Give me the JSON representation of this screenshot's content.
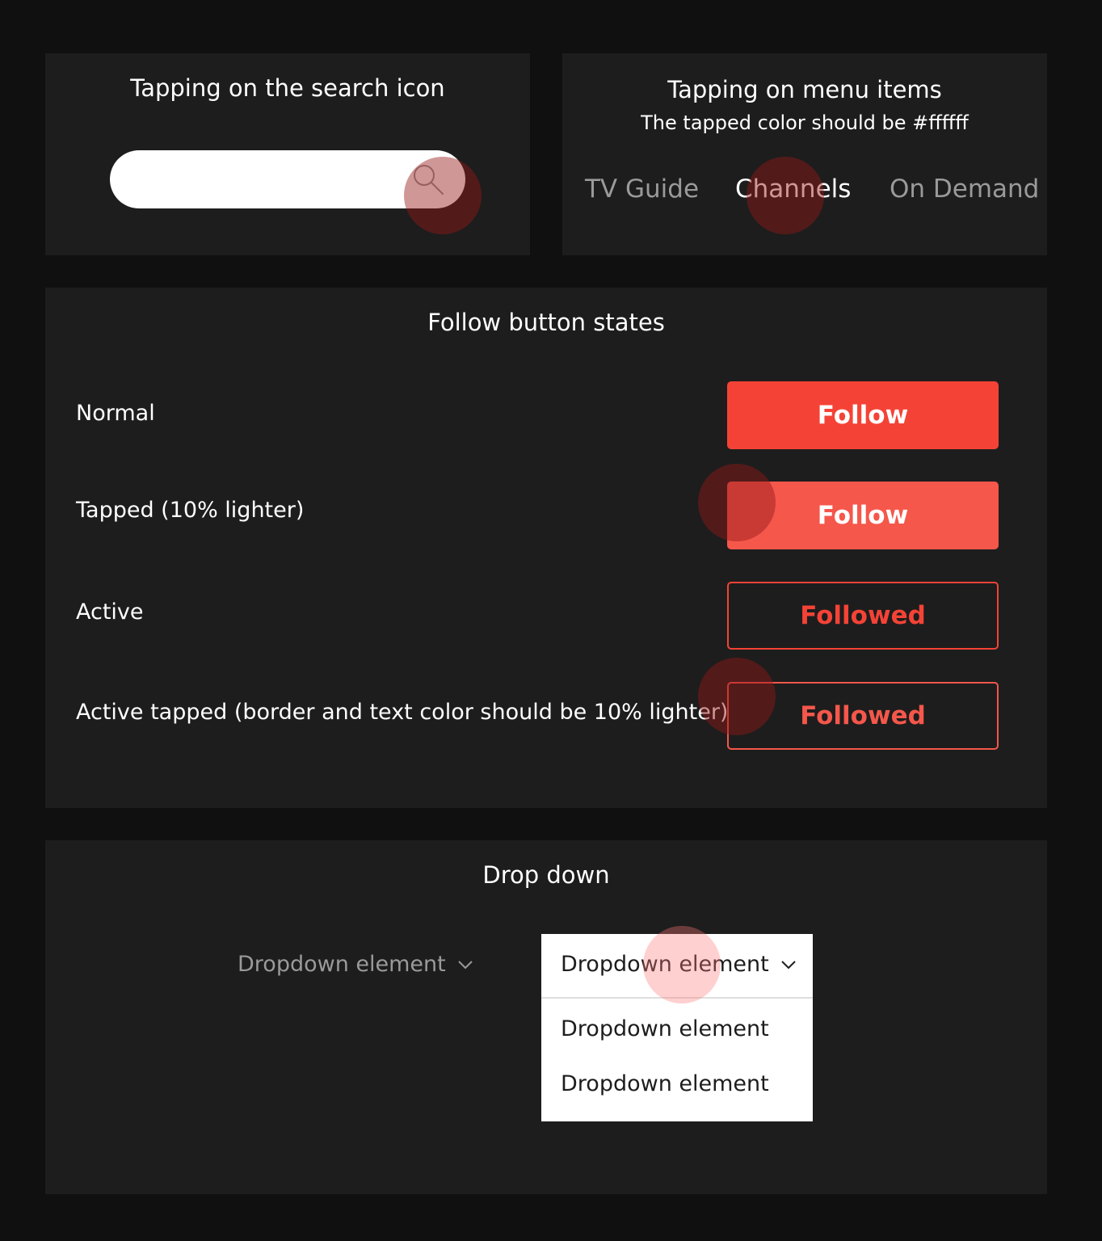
{
  "search_panel": {
    "title": "Tapping on the search icon",
    "icon": "search-icon"
  },
  "menu_panel": {
    "title": "Tapping on menu items",
    "subtitle": "The tapped color should be #ffffff",
    "items": [
      {
        "label": "TV Guide"
      },
      {
        "label": "Channels"
      },
      {
        "label": "On Demand"
      }
    ],
    "tapped_color": "#ffffff",
    "inactive_color": "#9a9a9a"
  },
  "follow_panel": {
    "title": "Follow button states",
    "rows": [
      {
        "label": "Normal",
        "button": "Follow"
      },
      {
        "label": "Tapped (10% lighter)",
        "button": "Follow"
      },
      {
        "label": "Active",
        "button": "Followed"
      },
      {
        "label": "Active tapped (border and text color should be 10% lighter)",
        "button": "Followed"
      }
    ],
    "colors": {
      "normal": "#f44336",
      "lighter": "#f5574b"
    }
  },
  "dropdown_panel": {
    "title": "Drop down",
    "closed_label": "Dropdown element",
    "open_label": "Dropdown element",
    "options": [
      "Dropdown element",
      "Dropdown element"
    ],
    "chevron_icon": "chevron-down-icon"
  },
  "colors": {
    "background": "#101010",
    "panel": "#1d1d1d",
    "accent": "#f44336"
  }
}
